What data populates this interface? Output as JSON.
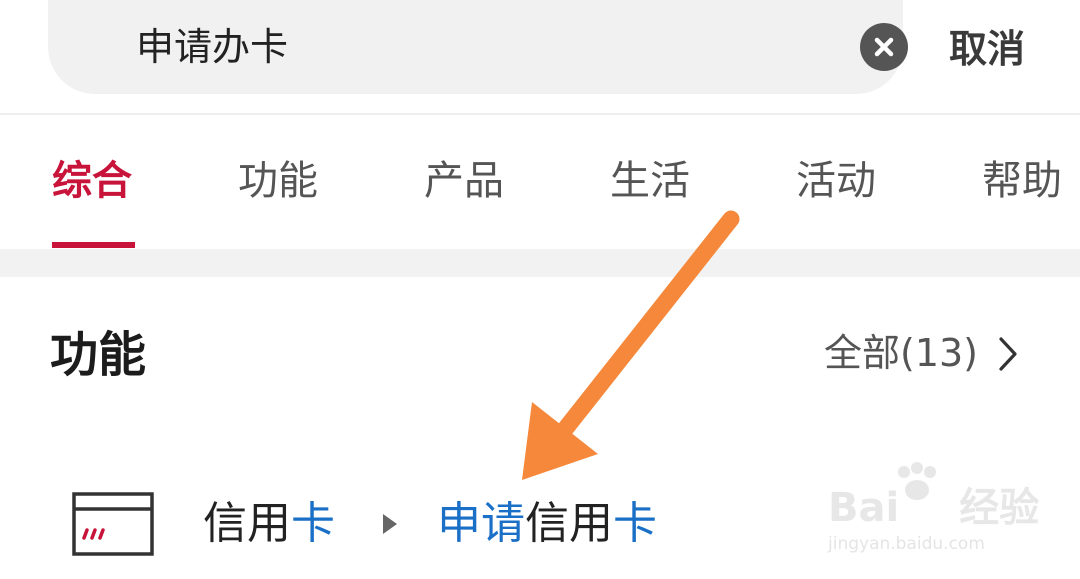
{
  "search": {
    "query": "申请办卡",
    "clear_icon": "close-circle-icon",
    "cancel_label": "取消"
  },
  "tabs": [
    {
      "label": "综合",
      "active": true
    },
    {
      "label": "功能",
      "active": false
    },
    {
      "label": "产品",
      "active": false
    },
    {
      "label": "生活",
      "active": false
    },
    {
      "label": "活动",
      "active": false
    },
    {
      "label": "帮助",
      "active": false
    }
  ],
  "section": {
    "title": "功能",
    "see_all_label": "全部(13)",
    "see_all_icon": "chevron-right-icon"
  },
  "results": [
    {
      "icon": "credit-card-icon",
      "breadcrumb_parent": {
        "plain": "信用",
        "highlight": "卡"
      },
      "separator_icon": "triangle-right-icon",
      "title": {
        "highlight1": "申请",
        "plain": "信用",
        "highlight2": "卡"
      }
    }
  ],
  "annotation": {
    "arrow_color": "#f5883a"
  },
  "watermark": {
    "logo_left": "Bai",
    "logo_right": "经验",
    "url": "jingyan.baidu.com"
  },
  "colors": {
    "accent_red": "#c8143b",
    "highlight_blue": "#1a6fc7",
    "search_bg": "#f1f1f1",
    "band_gray": "#f2f2f2"
  }
}
